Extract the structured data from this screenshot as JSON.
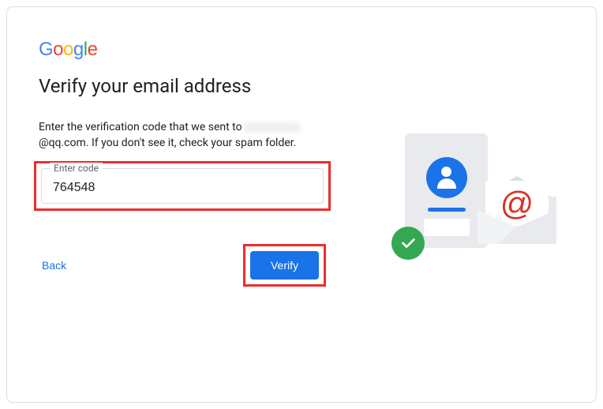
{
  "logo": {
    "g1": "G",
    "o1": "o",
    "o2": "o",
    "g2": "g",
    "l1": "l",
    "e1": "e"
  },
  "heading": "Verify your email address",
  "instruction_prefix": "Enter the verification code that we sent to ",
  "email_visible_suffix": "@qq.com",
  "instruction_suffix": ". If you don't see it, check your spam folder.",
  "field": {
    "label": "Enter code",
    "value": "764548"
  },
  "buttons": {
    "back": "Back",
    "verify": "Verify"
  },
  "illustration": {
    "at": "@",
    "check": "✓"
  },
  "colors": {
    "highlight": "#ee2c2c",
    "primary": "#1a73e8",
    "success": "#34a853",
    "danger": "#d93025"
  }
}
